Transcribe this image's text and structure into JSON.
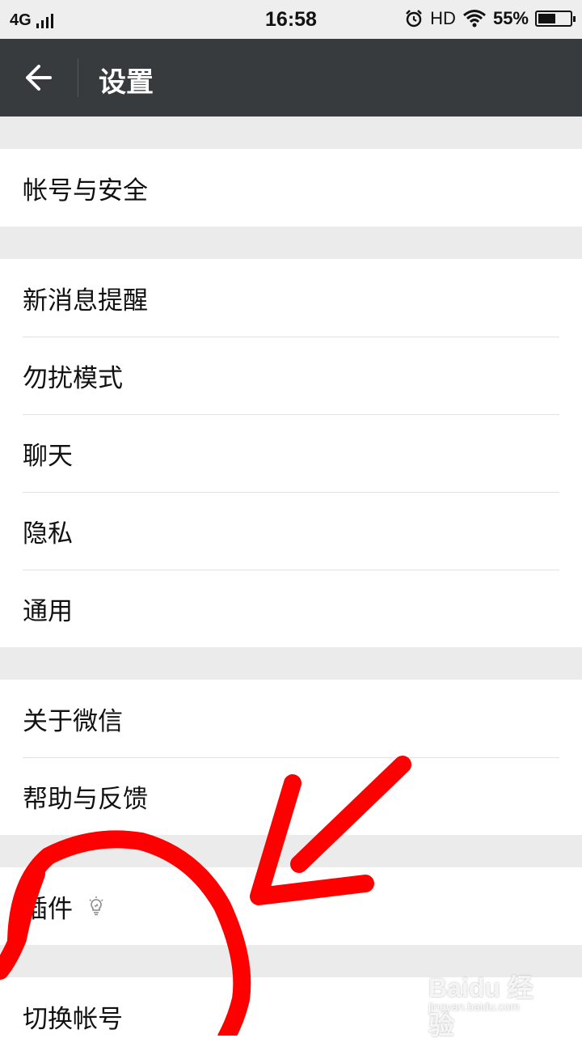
{
  "status_bar": {
    "network": "4G",
    "time": "16:58",
    "hd": "HD",
    "battery": "55%",
    "battery_level": 0.55
  },
  "header": {
    "title": "设置",
    "back_icon": "arrow-left-icon"
  },
  "groups": [
    {
      "items": [
        {
          "label": "帐号与安全"
        }
      ]
    },
    {
      "items": [
        {
          "label": "新消息提醒"
        },
        {
          "label": "勿扰模式"
        },
        {
          "label": "聊天"
        },
        {
          "label": "隐私"
        },
        {
          "label": "通用"
        }
      ]
    },
    {
      "items": [
        {
          "label": "关于微信"
        },
        {
          "label": "帮助与反馈"
        }
      ]
    },
    {
      "items": [
        {
          "label": "插件",
          "icon": "lightbulb-icon"
        }
      ]
    },
    {
      "items": [
        {
          "label": "切换帐号"
        }
      ]
    }
  ],
  "annotation": {
    "color": "#ff0000"
  },
  "watermark": {
    "brand": "Baidu 经验",
    "url": "jingyan.baidu.com"
  },
  "colors": {
    "header_bg": "#383b3e",
    "page_bg": "#ebebeb",
    "item_bg": "#ffffff"
  }
}
